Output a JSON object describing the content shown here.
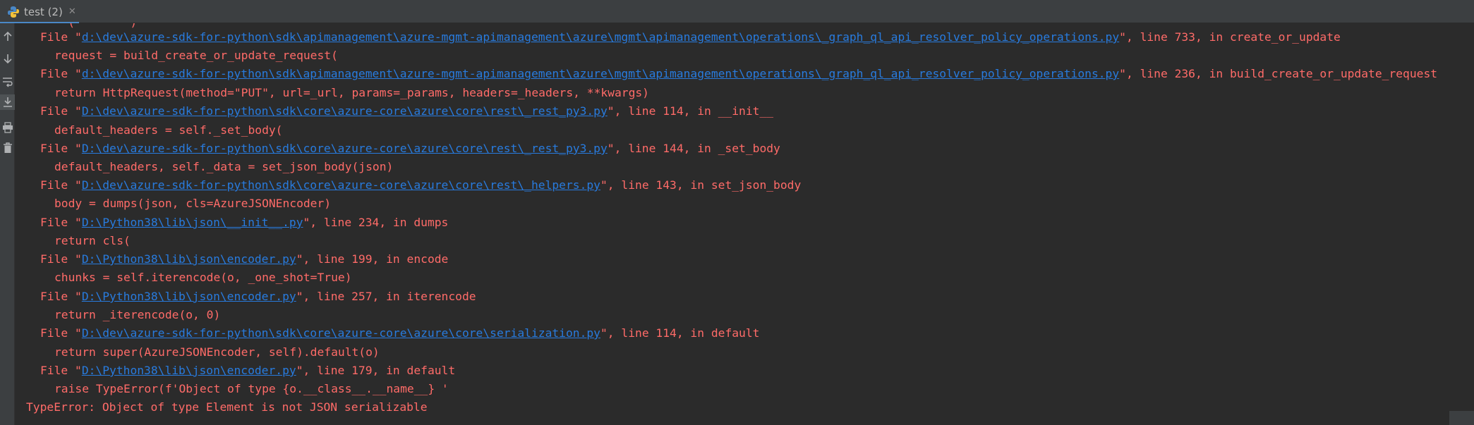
{
  "tab": {
    "label": "test (2)",
    "close": "✕"
  },
  "gutter": {
    "icons": [
      "up-arrow-icon",
      "down-arrow-icon",
      "soft-wrap-icon",
      "scroll-to-end-icon",
      "print-icon",
      "trash-icon"
    ]
  },
  "console": {
    "partial_top": "    (        )",
    "lines": [
      {
        "prefix": "File \"",
        "link": "d:\\dev\\azure-sdk-for-python\\sdk\\apimanagement\\azure-mgmt-apimanagement\\azure\\mgmt\\apimanagement\\operations\\_graph_ql_api_resolver_policy_operations.py",
        "suffix": "\", line 733, in create_or_update"
      },
      {
        "text": "request = build_create_or_update_request("
      },
      {
        "prefix": "File \"",
        "link": "d:\\dev\\azure-sdk-for-python\\sdk\\apimanagement\\azure-mgmt-apimanagement\\azure\\mgmt\\apimanagement\\operations\\_graph_ql_api_resolver_policy_operations.py",
        "suffix": "\", line 236, in build_create_or_update_request"
      },
      {
        "text": "return HttpRequest(method=\"PUT\", url=_url, params=_params, headers=_headers, **kwargs)"
      },
      {
        "prefix": "File \"",
        "link": "D:\\dev\\azure-sdk-for-python\\sdk\\core\\azure-core\\azure\\core\\rest\\_rest_py3.py",
        "suffix": "\", line 114, in __init__"
      },
      {
        "text": "default_headers = self._set_body("
      },
      {
        "prefix": "File \"",
        "link": "D:\\dev\\azure-sdk-for-python\\sdk\\core\\azure-core\\azure\\core\\rest\\_rest_py3.py",
        "suffix": "\", line 144, in _set_body"
      },
      {
        "text": "default_headers, self._data = set_json_body(json)"
      },
      {
        "prefix": "File \"",
        "link": "D:\\dev\\azure-sdk-for-python\\sdk\\core\\azure-core\\azure\\core\\rest\\_helpers.py",
        "suffix": "\", line 143, in set_json_body"
      },
      {
        "text": "body = dumps(json, cls=AzureJSONEncoder)"
      },
      {
        "prefix": "File \"",
        "link": "D:\\Python38\\lib\\json\\__init__.py",
        "suffix": "\", line 234, in dumps"
      },
      {
        "text": "return cls("
      },
      {
        "prefix": "File \"",
        "link": "D:\\Python38\\lib\\json\\encoder.py",
        "suffix": "\", line 199, in encode"
      },
      {
        "text": "chunks = self.iterencode(o, _one_shot=True)"
      },
      {
        "prefix": "File \"",
        "link": "D:\\Python38\\lib\\json\\encoder.py",
        "suffix": "\", line 257, in iterencode"
      },
      {
        "text": "return _iterencode(o, 0)"
      },
      {
        "prefix": "File \"",
        "link": "D:\\dev\\azure-sdk-for-python\\sdk\\core\\azure-core\\azure\\core\\serialization.py",
        "suffix": "\", line 114, in default"
      },
      {
        "text": "return super(AzureJSONEncoder, self).default(o)"
      },
      {
        "prefix": "File \"",
        "link": "D:\\Python38\\lib\\json\\encoder.py",
        "suffix": "\", line 179, in default"
      },
      {
        "text": "raise TypeError(f'Object of type {o.__class__.__name__} '"
      }
    ],
    "error": "TypeError: Object of type Element is not JSON serializable"
  },
  "colors": {
    "error_text": "#ff6b68",
    "link": "#287bde",
    "background": "#2b2b2b",
    "panel": "#3c3f41",
    "tab_underline": "#4a88c7"
  }
}
